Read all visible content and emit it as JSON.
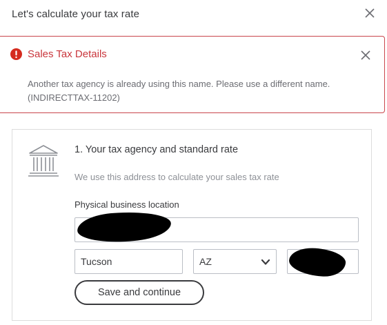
{
  "header": {
    "title": "Let's calculate your tax rate",
    "close_icon": "close-icon"
  },
  "alert": {
    "title": "Sales Tax Details",
    "message": "Another tax agency is already using this name. Please use a different name. (INDIRECTTAX-11202)",
    "icon": "error-icon",
    "close_icon": "close-icon",
    "color": "#c9353b"
  },
  "agency": {
    "icon": "bank-building-icon",
    "title": "1. Your tax agency and standard rate",
    "description": "We use this address to calculate your sales tax rate",
    "location_label": "Physical business location",
    "address_value": "",
    "city_value": "Tucson",
    "state_value": "AZ",
    "state_icon": "chevron-down-icon",
    "zip_value": "",
    "save_label": "Save and continue"
  }
}
